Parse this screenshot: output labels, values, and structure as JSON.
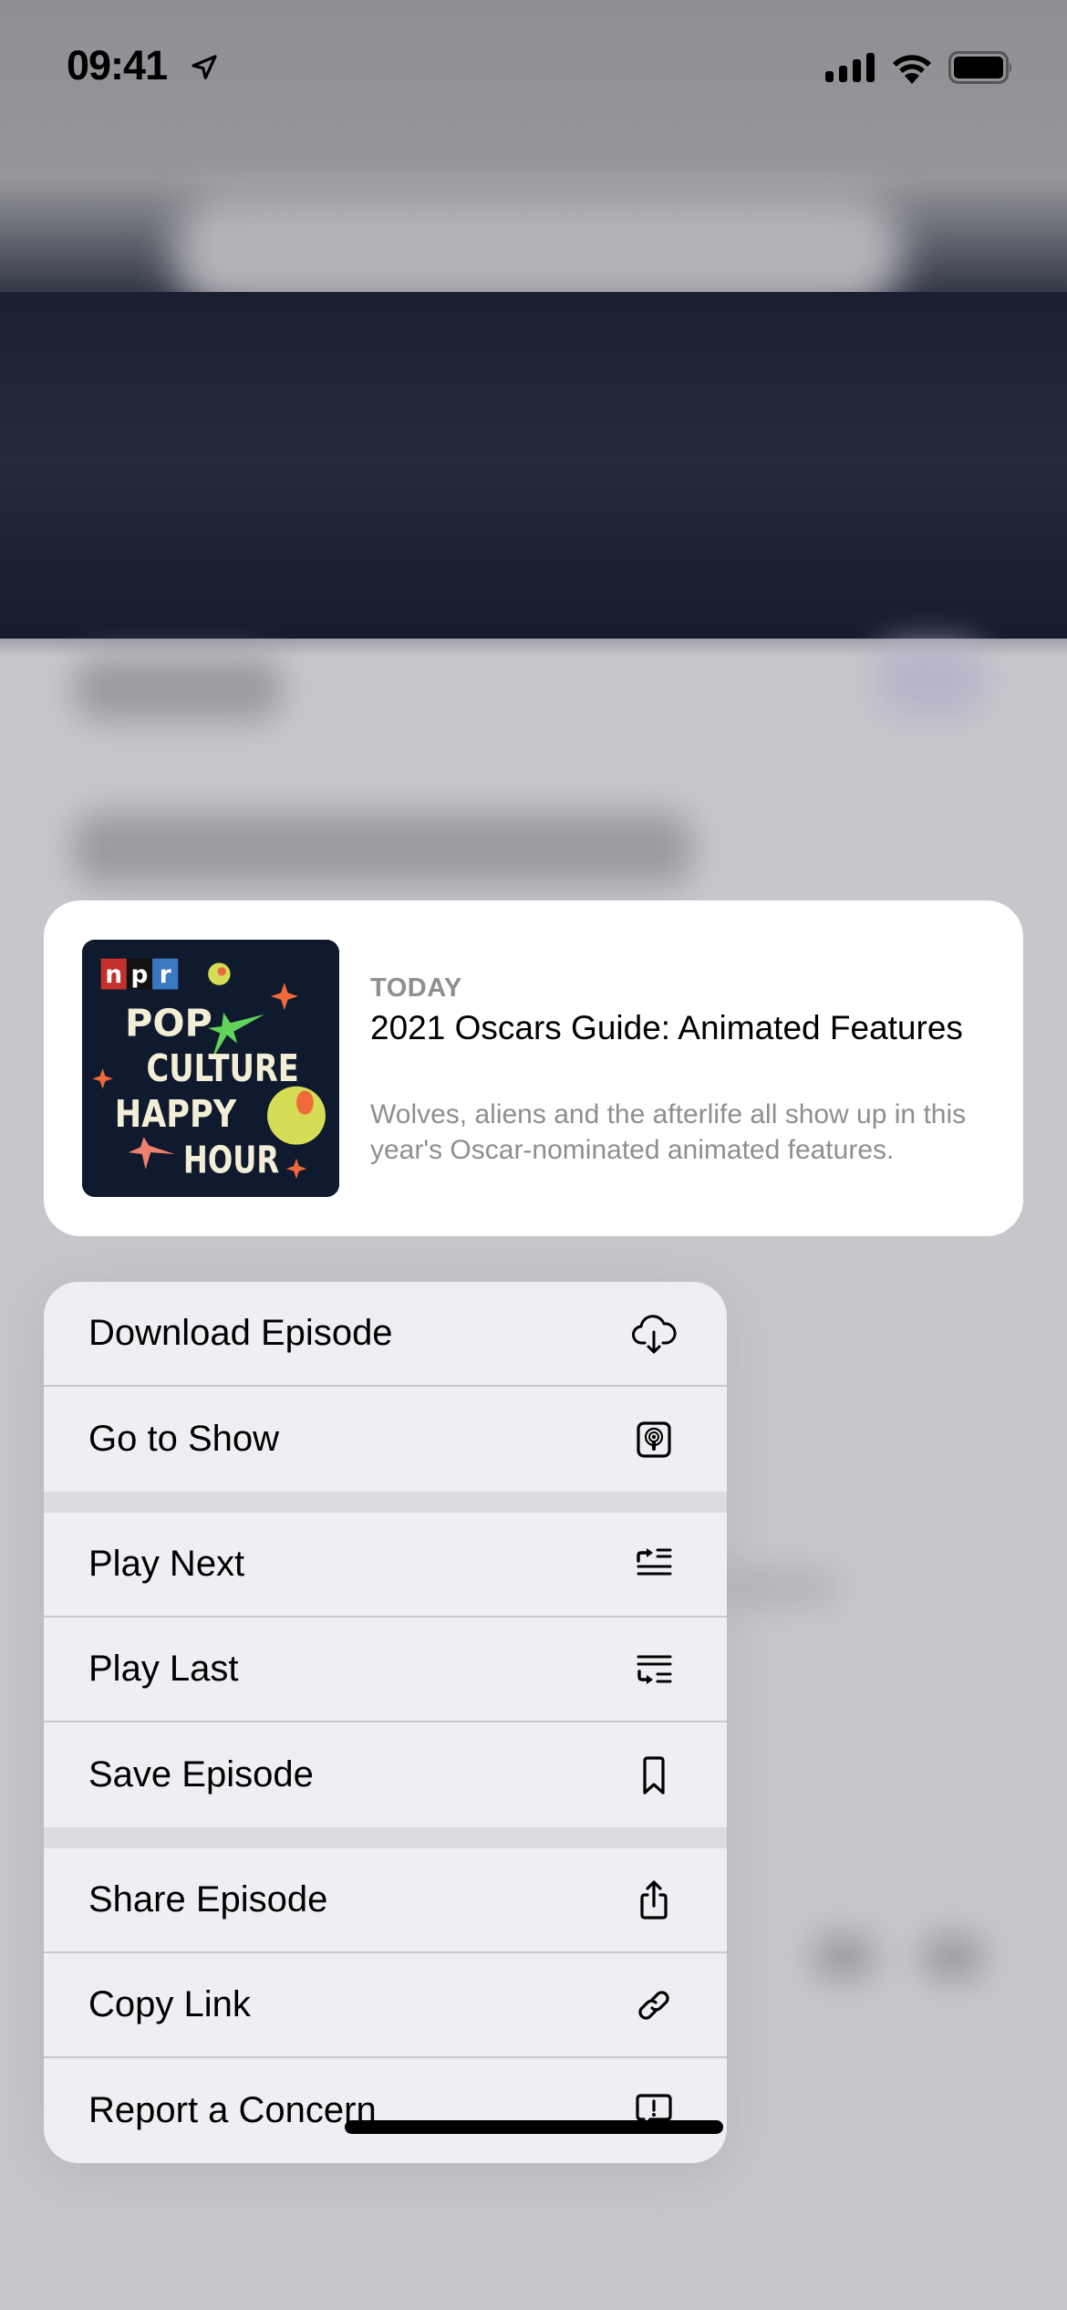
{
  "status_bar": {
    "time": "09:41",
    "icons": [
      "location-arrow-icon",
      "cellular-signal-icon",
      "wifi-icon",
      "battery-icon"
    ]
  },
  "preview": {
    "artwork": {
      "network_letters": [
        "n",
        "p",
        "r"
      ],
      "lines": [
        "POP",
        "CULTURE",
        "HAPPY",
        "HOUR"
      ],
      "colors": {
        "background": "#0f1a2e",
        "text": "#f3efd6",
        "npr_n": "#c4302b",
        "npr_p": "#111111",
        "npr_r": "#3a78c0",
        "green": "#5fd35a",
        "orange": "#ef6a3a",
        "yellow": "#d5dc55",
        "pink": "#f08070"
      }
    },
    "date_label": "TODAY",
    "title": "2021 Oscars Guide: Animated Features",
    "description": "Wolves, aliens and the afterlife all show up in this year's Oscar-nominated animated features."
  },
  "menu": {
    "groups": [
      [
        {
          "label": "Download Episode",
          "icon": "cloud-download-icon"
        },
        {
          "label": "Go to Show",
          "icon": "podcast-app-icon"
        }
      ],
      [
        {
          "label": "Play Next",
          "icon": "play-next-icon"
        },
        {
          "label": "Play Last",
          "icon": "play-last-icon"
        },
        {
          "label": "Save Episode",
          "icon": "bookmark-icon"
        }
      ],
      [
        {
          "label": "Share Episode",
          "icon": "share-icon"
        },
        {
          "label": "Copy Link",
          "icon": "link-icon"
        },
        {
          "label": "Report a Concern",
          "icon": "report-concern-icon"
        }
      ]
    ]
  }
}
